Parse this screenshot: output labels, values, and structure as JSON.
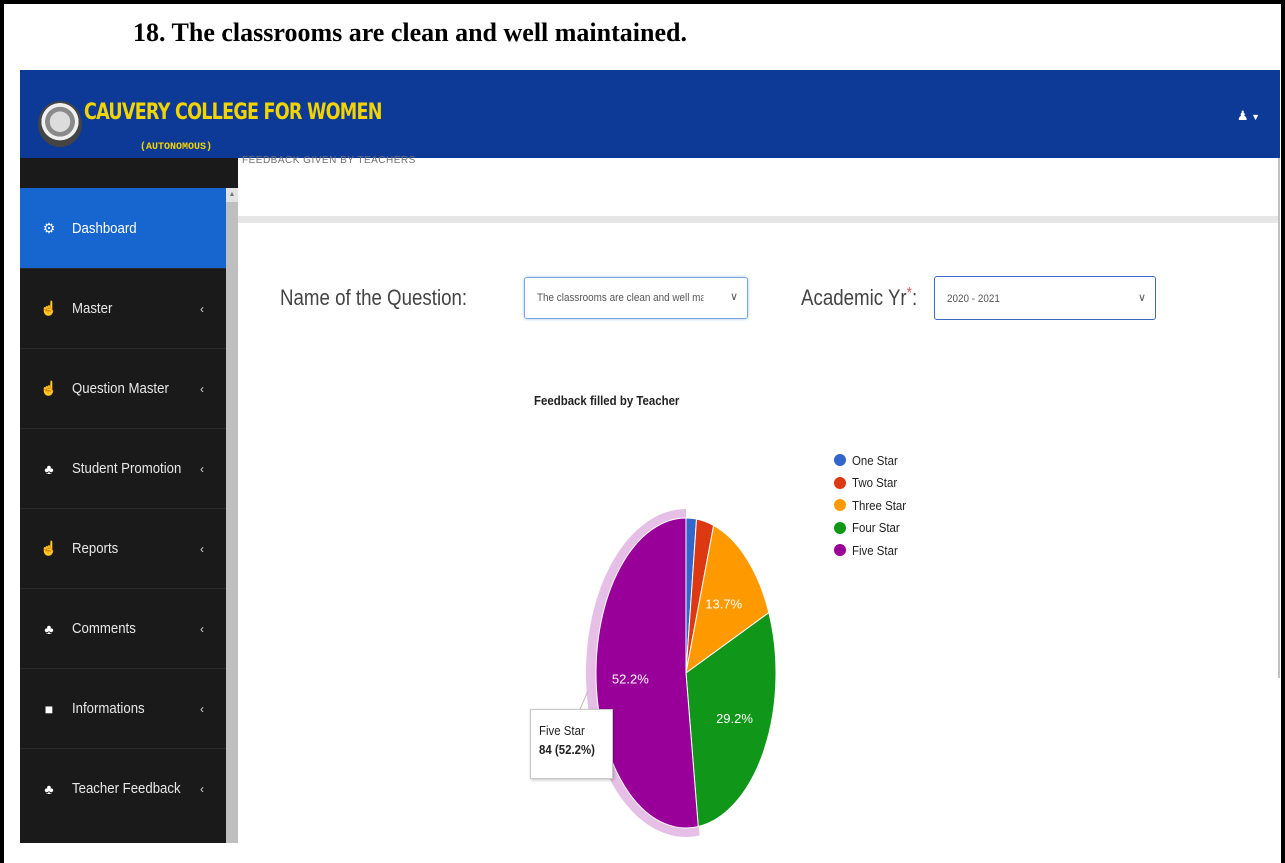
{
  "document": {
    "heading": "18. The classrooms are clean and well maintained."
  },
  "header": {
    "college_name": "CAUVERY COLLEGE FOR WOMEN",
    "college_subtitle": "(AUTONOMOUS)",
    "user_icon": "user-icon"
  },
  "breadcrumb": {
    "text": "FEEDBACK GIVEN BY TEACHERS"
  },
  "sidebar": {
    "items": [
      {
        "label": "Dashboard",
        "icon": "dashboard-icon",
        "glyph": "⚙",
        "active": true
      },
      {
        "label": "Master",
        "icon": "hand-icon",
        "glyph": "☝",
        "active": false
      },
      {
        "label": "Question Master",
        "icon": "hand-icon",
        "glyph": "☝",
        "active": false
      },
      {
        "label": "Student Promotion",
        "icon": "sitemap-icon",
        "glyph": "♣",
        "active": false
      },
      {
        "label": "Reports",
        "icon": "hand-icon",
        "glyph": "☝",
        "active": false
      },
      {
        "label": "Comments",
        "icon": "sitemap-icon",
        "glyph": "♣",
        "active": false
      },
      {
        "label": "Informations",
        "icon": "book-icon",
        "glyph": "■",
        "active": false
      },
      {
        "label": "Teacher Feedback",
        "icon": "sitemap-icon",
        "glyph": "♣",
        "active": false
      }
    ]
  },
  "filters": {
    "question_label": "Name of the Question:",
    "question_value": "The classrooms are clean and well maintained.",
    "year_label": "Academic Yr",
    "year_required": "*",
    "year_label_suffix": ":",
    "year_value": "2020 - 2021"
  },
  "chart_data": {
    "type": "pie",
    "title": "Feedback filled by Teacher",
    "series": [
      {
        "name": "One Star",
        "value": 3,
        "percent": 1.9,
        "label": "",
        "color": "#3366cc"
      },
      {
        "name": "Two Star",
        "value": 5,
        "percent": 3.1,
        "label": "",
        "color": "#dc3912"
      },
      {
        "name": "Three Star",
        "value": 22,
        "percent": 13.7,
        "label": "13.7%",
        "color": "#ff9900"
      },
      {
        "name": "Four Star",
        "value": 47,
        "percent": 29.2,
        "label": "29.2%",
        "color": "#109618"
      },
      {
        "name": "Five Star",
        "value": 84,
        "percent": 52.2,
        "label": "52.2%",
        "color": "#990099"
      }
    ],
    "highlighted": "Five Star",
    "legend_position": "right"
  },
  "tooltip": {
    "series_name": "Five Star",
    "value_text": "84 (52.2%)"
  }
}
